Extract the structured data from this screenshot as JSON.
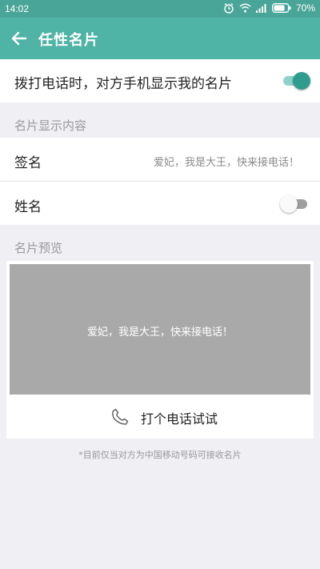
{
  "status_bar": {
    "time": "14:02",
    "battery_percent": "70%",
    "icons": [
      "alarm-icon",
      "wifi-icon",
      "signal-icon",
      "battery-icon"
    ]
  },
  "app_bar": {
    "title": "任性名片",
    "back_icon": "back-arrow-icon"
  },
  "settings": {
    "show_card_label": "拨打电话时，对方手机显示我的名片",
    "show_card_enabled": true,
    "content_section_title": "名片显示内容",
    "signature_label": "签名",
    "signature_value": "爱妃，我是大王，快来接电话！",
    "name_label": "姓名",
    "name_enabled": false
  },
  "preview": {
    "section_title": "名片预览",
    "card_text": "爱妃，我是大王，快来接电话！",
    "call_button_label": "打个电话试试",
    "call_icon": "phone-icon"
  },
  "footnote": "*目前仅当对方为中国移动号码可接收名片",
  "colors": {
    "accent": "#4fb3a6",
    "status_bar": "#4aa599",
    "toggle_on": "#2e9c8e",
    "preview_bg": "#a9a9a9",
    "page_bg": "#efeff4"
  }
}
